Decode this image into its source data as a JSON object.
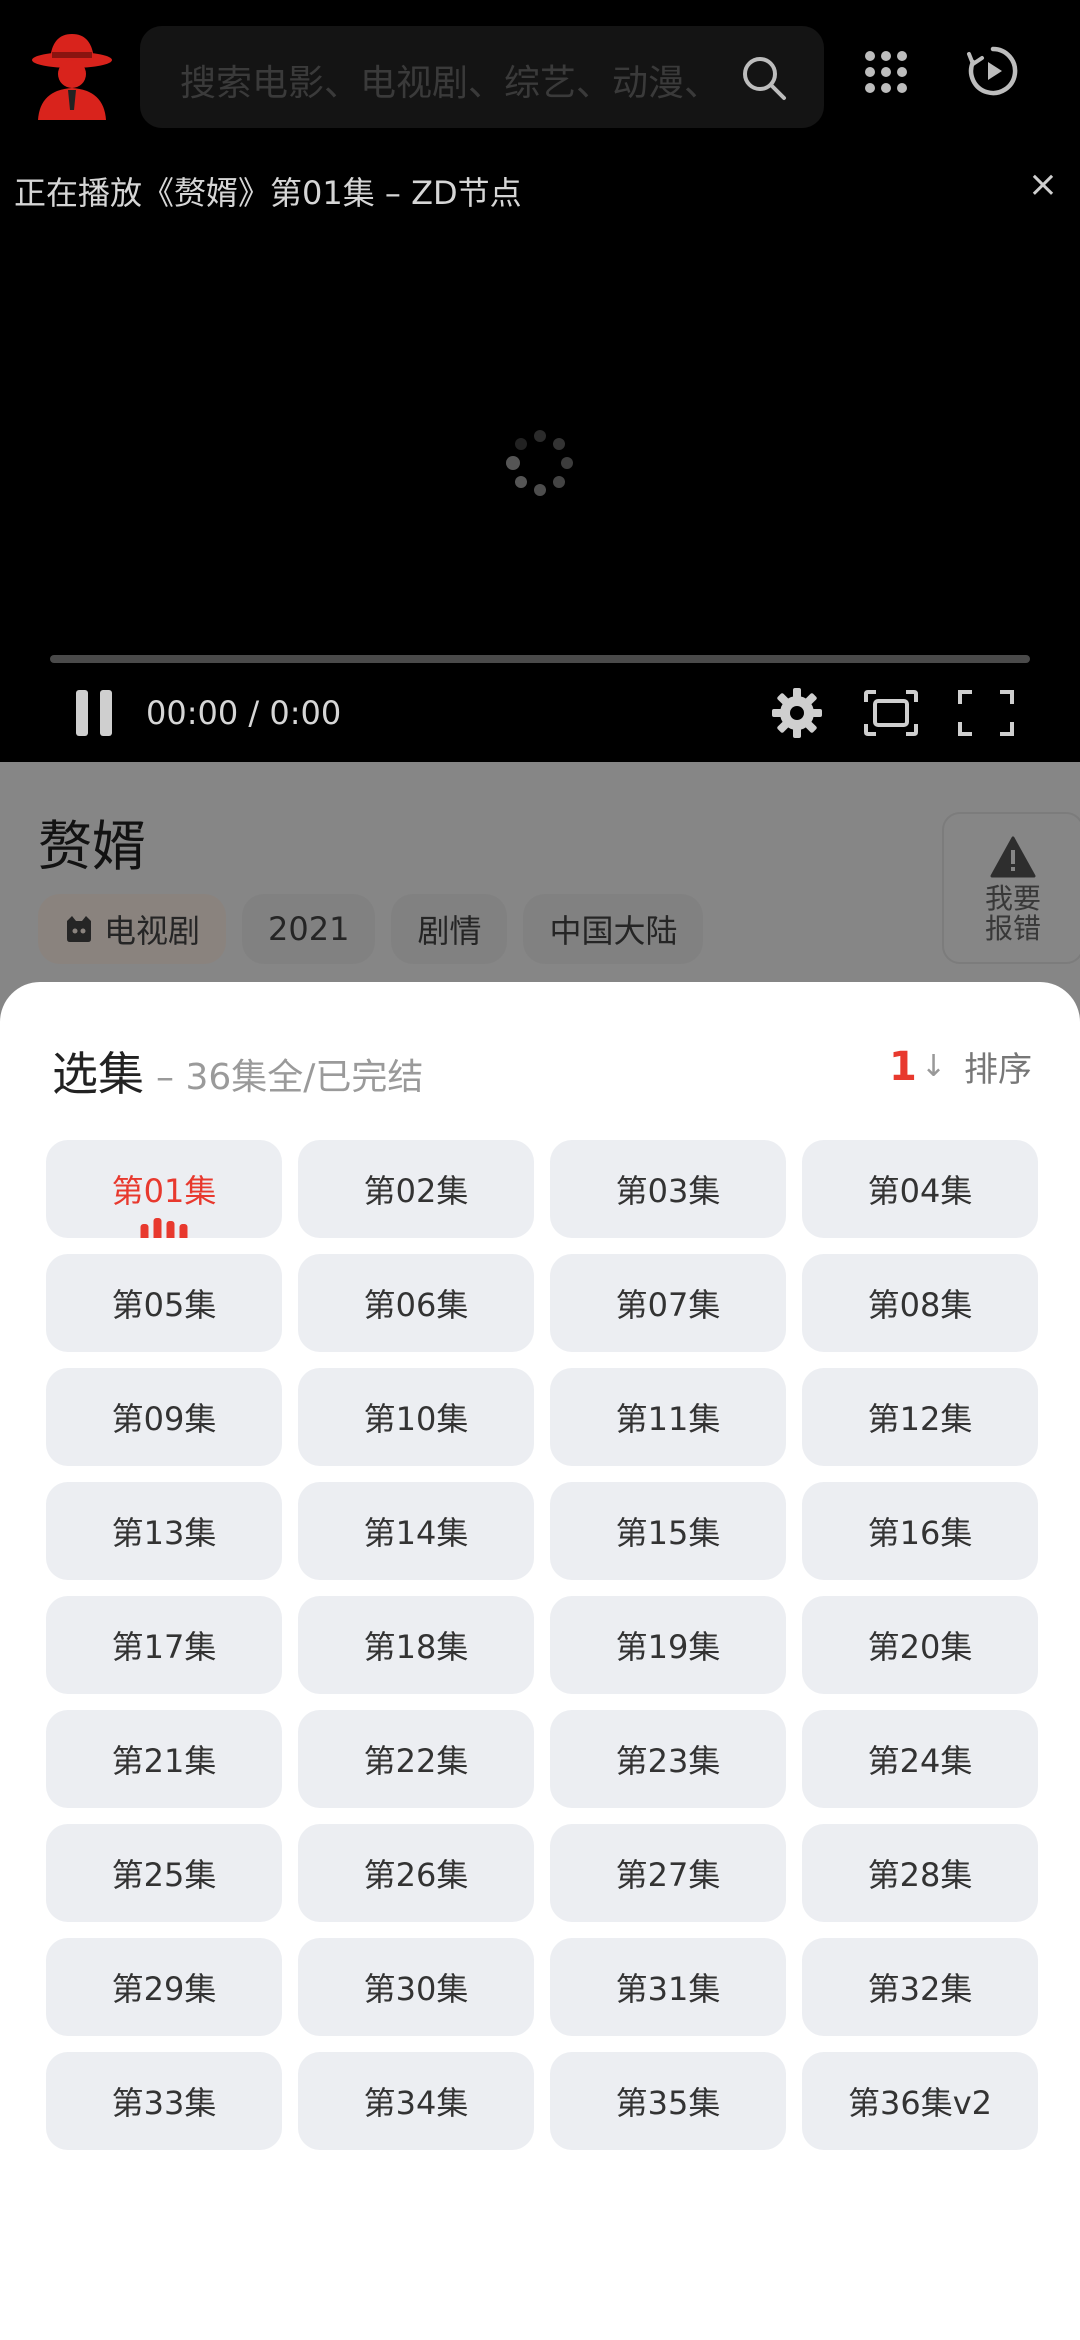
{
  "header": {
    "search_placeholder": "搜索电影、电视剧、综艺、动漫、",
    "logo_icon": "red-hat-agent-logo",
    "apps_icon": "grid-dots-icon",
    "history_icon": "play-history-icon"
  },
  "player": {
    "now_playing": "正在播放《赘婿》第01集 – ZD节点",
    "close_label": "×",
    "time": "00:00 / 0:00",
    "progress": 0
  },
  "info": {
    "title": "赘婿",
    "tags": [
      "电视剧",
      "2021",
      "剧情",
      "中国大陆"
    ],
    "report_label_1": "我要",
    "report_label_2": "报错"
  },
  "sheet": {
    "title": "选集",
    "subtitle": "– 36集全/已完结",
    "sort_number": "1",
    "sort_label": "排序",
    "accent": "#e8392e",
    "episodes": [
      "第01集",
      "第02集",
      "第03集",
      "第04集",
      "第05集",
      "第06集",
      "第07集",
      "第08集",
      "第09集",
      "第10集",
      "第11集",
      "第12集",
      "第13集",
      "第14集",
      "第15集",
      "第16集",
      "第17集",
      "第18集",
      "第19集",
      "第20集",
      "第21集",
      "第22集",
      "第23集",
      "第24集",
      "第25集",
      "第26集",
      "第27集",
      "第28集",
      "第29集",
      "第30集",
      "第31集",
      "第32集",
      "第33集",
      "第34集",
      "第35集",
      "第36集v2"
    ],
    "active_index": 0
  }
}
